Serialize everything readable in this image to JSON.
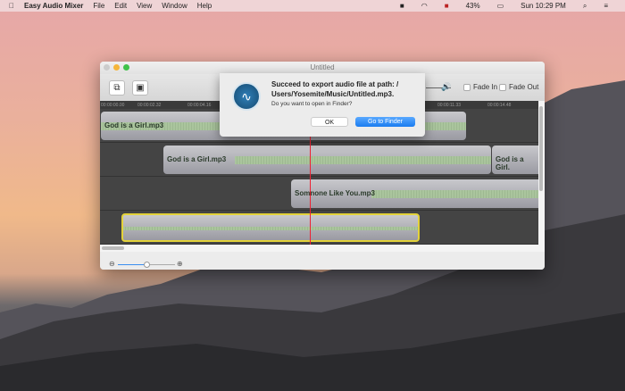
{
  "menubar": {
    "app": "Easy Audio Mixer",
    "menus": [
      "File",
      "Edit",
      "View",
      "Window",
      "Help"
    ],
    "battery": "43%",
    "clock": "Sun 10:29 PM"
  },
  "window": {
    "title": "Untitled",
    "fade_in": "Fade In",
    "fade_out": "Fade Out",
    "ruler": [
      "00:00:00.00",
      "00:00:02.32",
      "00:00:04.16",
      "00:00:11.33",
      "00:00:14.48"
    ],
    "zoom_level": 0.5,
    "tracks": [
      {
        "clips": [
          "God is a Girl.mp3"
        ]
      },
      {
        "clips": [
          "God is a Girl.mp3",
          "God is a Girl."
        ]
      },
      {
        "clips": [
          "Somnone Like You.mp3"
        ]
      },
      {
        "clips": [
          ""
        ]
      }
    ]
  },
  "dialog": {
    "title": "Succeed to export audio file at path: / Users/Yosemite/Music/Untitled.mp3.",
    "message": "Do you want to open in Finder?",
    "ok": "OK",
    "go": "Go to Finder"
  }
}
